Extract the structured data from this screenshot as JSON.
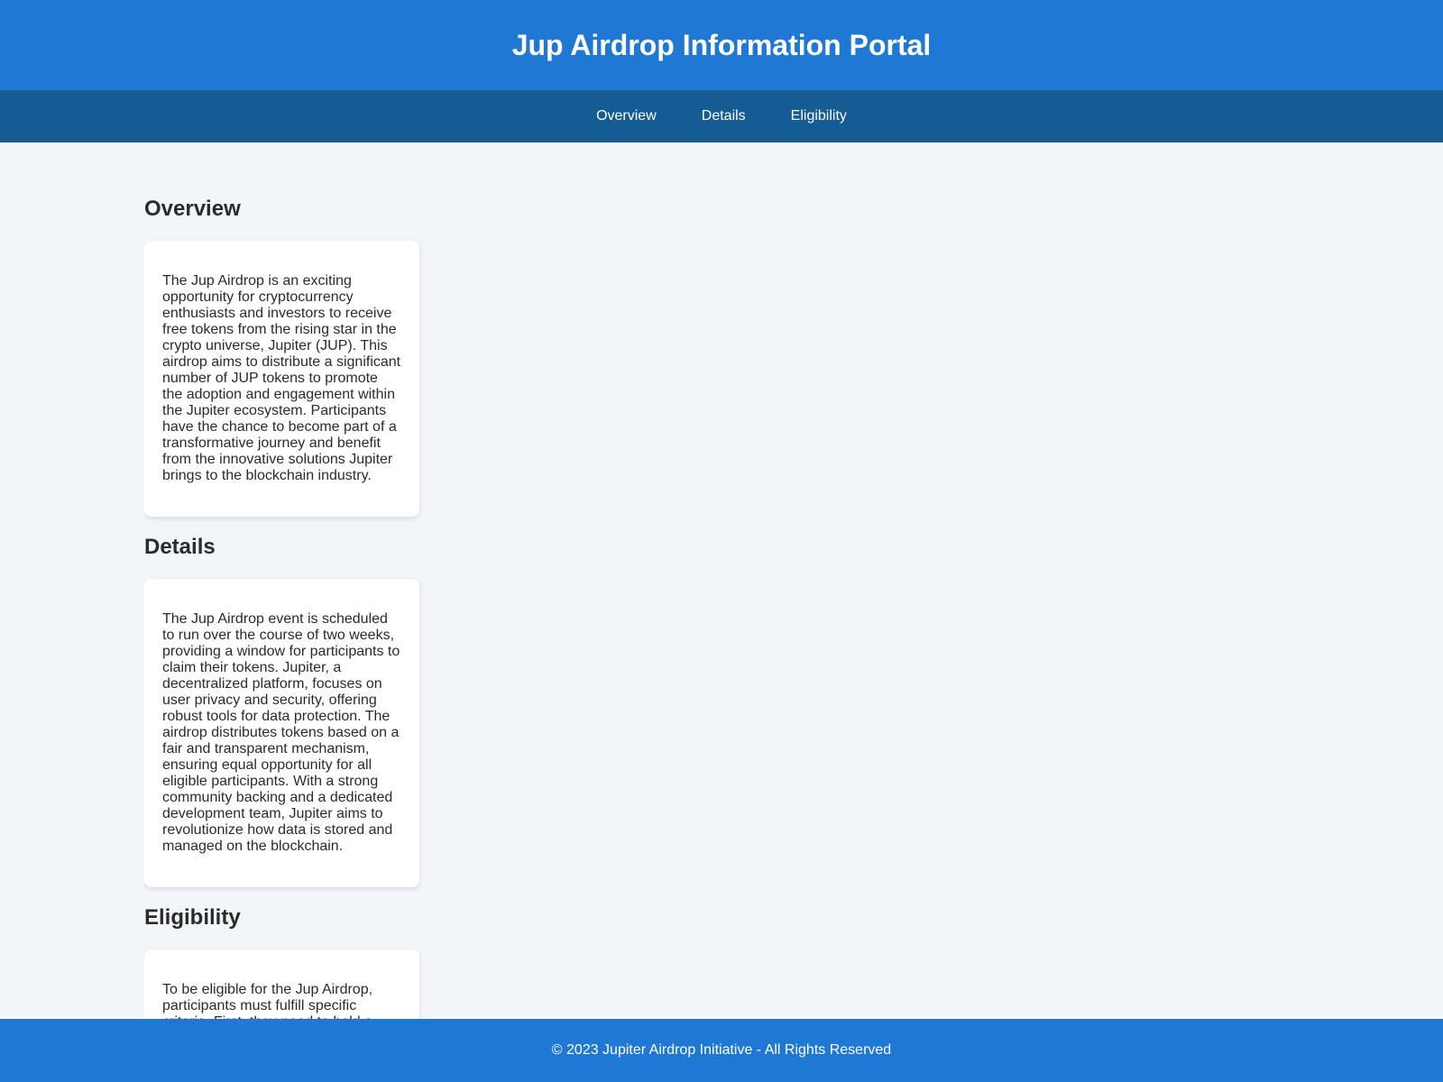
{
  "header": {
    "title": "Jup Airdrop Information Portal"
  },
  "nav": {
    "items": [
      {
        "label": "Overview"
      },
      {
        "label": "Details"
      },
      {
        "label": "Eligibility"
      }
    ]
  },
  "sections": [
    {
      "title": "Overview",
      "body": "The Jup Airdrop is an exciting opportunity for cryptocurrency enthusiasts and investors to receive free tokens from the rising star in the crypto universe, Jupiter (JUP). This airdrop aims to distribute a significant number of JUP tokens to promote the adoption and engagement within the Jupiter ecosystem. Participants have the chance to become part of a transformative journey and benefit from the innovative solutions Jupiter brings to the blockchain industry."
    },
    {
      "title": "Details",
      "body": "The Jup Airdrop event is scheduled to run over the course of two weeks, providing a window for participants to claim their tokens. Jupiter, a decentralized platform, focuses on user privacy and security, offering robust tools for data protection. The airdrop distributes tokens based on a fair and transparent mechanism, ensuring equal opportunity for all eligible participants. With a strong community backing and a dedicated development team, Jupiter aims to revolutionize how data is stored and managed on the blockchain."
    },
    {
      "title": "Eligibility",
      "body": "To be eligible for the Jup Airdrop, participants must fulfill specific criteria. First, they need to hold a"
    }
  ],
  "footer": {
    "text": "© 2023 Jupiter Airdrop Initiative - All Rights Reserved"
  },
  "colors": {
    "header_bg": "#1f78d4",
    "nav_bg": "#145c93",
    "page_bg": "#f3f6f9",
    "card_bg": "#ffffff"
  }
}
